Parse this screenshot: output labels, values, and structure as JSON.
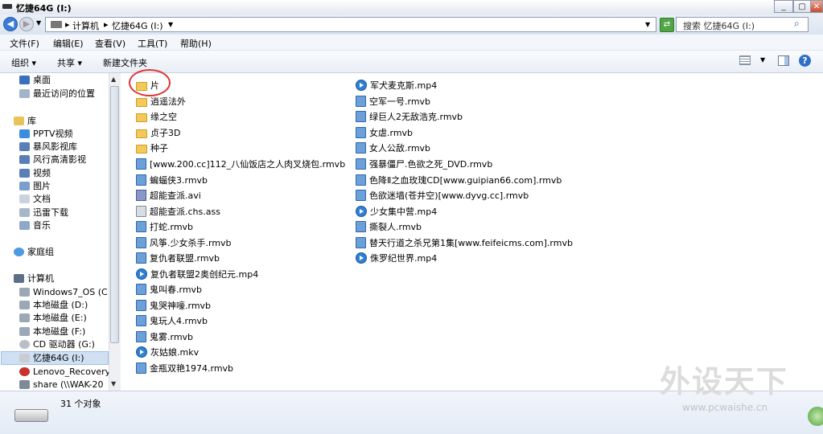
{
  "window": {
    "title": "忆捷64G (I:)"
  },
  "address": {
    "crumbs": [
      "计算机",
      "忆捷64G (I:)"
    ],
    "search_placeholder": "搜索 忆捷64G (I:)"
  },
  "menu": [
    "文件(F)",
    "编辑(E)",
    "查看(V)",
    "工具(T)",
    "帮助(H)"
  ],
  "toolbar": {
    "organize": "组织 ▾",
    "share": "共享 ▾",
    "new_folder": "新建文件夹"
  },
  "nav": {
    "favorites": [
      "桌面",
      "最近访问的位置"
    ],
    "library_header": "库",
    "library": [
      "PPTV视频",
      "暴风影视库",
      "风行高清影视",
      "视频",
      "图片",
      "文档",
      "迅雷下载",
      "音乐"
    ],
    "homegroup": "家庭组",
    "computer_header": "计算机",
    "drives": [
      "Windows7_OS (C:",
      "本地磁盘 (D:)",
      "本地磁盘 (E:)",
      "本地磁盘 (F:)",
      "CD 驱动器 (G:)",
      "忆捷64G (I:)",
      "Lenovo_Recovery",
      "share (\\\\WAK-20"
    ]
  },
  "files_col1": [
    {
      "name": "片",
      "type": "folder"
    },
    {
      "name": "逍遥法外",
      "type": "folder"
    },
    {
      "name": "缘之空",
      "type": "folder"
    },
    {
      "name": "贞子3D",
      "type": "folder"
    },
    {
      "name": "种子",
      "type": "folder"
    },
    {
      "name": "[www.200.cc]112_八仙饭店之人肉叉烧包.rmvb",
      "type": "rmvb"
    },
    {
      "name": "蝙蝠侠3.rmvb",
      "type": "rmvb"
    },
    {
      "name": "超能查派.avi",
      "type": "avi"
    },
    {
      "name": "超能查派.chs.ass",
      "type": "doc"
    },
    {
      "name": "打蛇.rmvb",
      "type": "rmvb"
    },
    {
      "name": "风筝.少女杀手.rmvb",
      "type": "rmvb"
    },
    {
      "name": "复仇者联盟.rmvb",
      "type": "rmvb"
    },
    {
      "name": "复仇者联盟2奥创纪元.mp4",
      "type": "mp4"
    },
    {
      "name": "鬼叫春.rmvb",
      "type": "rmvb"
    },
    {
      "name": "鬼哭神嚎.rmvb",
      "type": "rmvb"
    },
    {
      "name": "鬼玩人4.rmvb",
      "type": "rmvb"
    },
    {
      "name": "鬼雾.rmvb",
      "type": "rmvb"
    },
    {
      "name": "灰姑娘.mkv",
      "type": "mp4"
    },
    {
      "name": "金瓶双艳1974.rmvb",
      "type": "rmvb"
    }
  ],
  "files_col2": [
    {
      "name": "军犬麦克斯.mp4",
      "type": "mp4"
    },
    {
      "name": "空军一号.rmvb",
      "type": "rmvb"
    },
    {
      "name": "绿巨人2无敌浩克.rmvb",
      "type": "rmvb"
    },
    {
      "name": "女虐.rmvb",
      "type": "rmvb"
    },
    {
      "name": "女人公敌.rmvb",
      "type": "rmvb"
    },
    {
      "name": "强暴僵尸.色欲之死_DVD.rmvb",
      "type": "rmvb"
    },
    {
      "name": "色降Ⅱ之血玫瑰CD[www.guipian66.com].rmvb",
      "type": "rmvb"
    },
    {
      "name": "色欲迷墙(苍井空)[www.dyvg.cc].rmvb",
      "type": "rmvb"
    },
    {
      "name": "少女集中营.mp4",
      "type": "mp4"
    },
    {
      "name": "撕裂人.rmvb",
      "type": "rmvb"
    },
    {
      "name": "替天行道之杀兄第1集[www.feifeicms.com].rmvb",
      "type": "rmvb"
    },
    {
      "name": "侏罗纪世界.mp4",
      "type": "mp4"
    }
  ],
  "status": {
    "count": "31 个对象"
  },
  "watermark": {
    "logo": "外设天下",
    "url": "www.pcwaishe.cn"
  }
}
